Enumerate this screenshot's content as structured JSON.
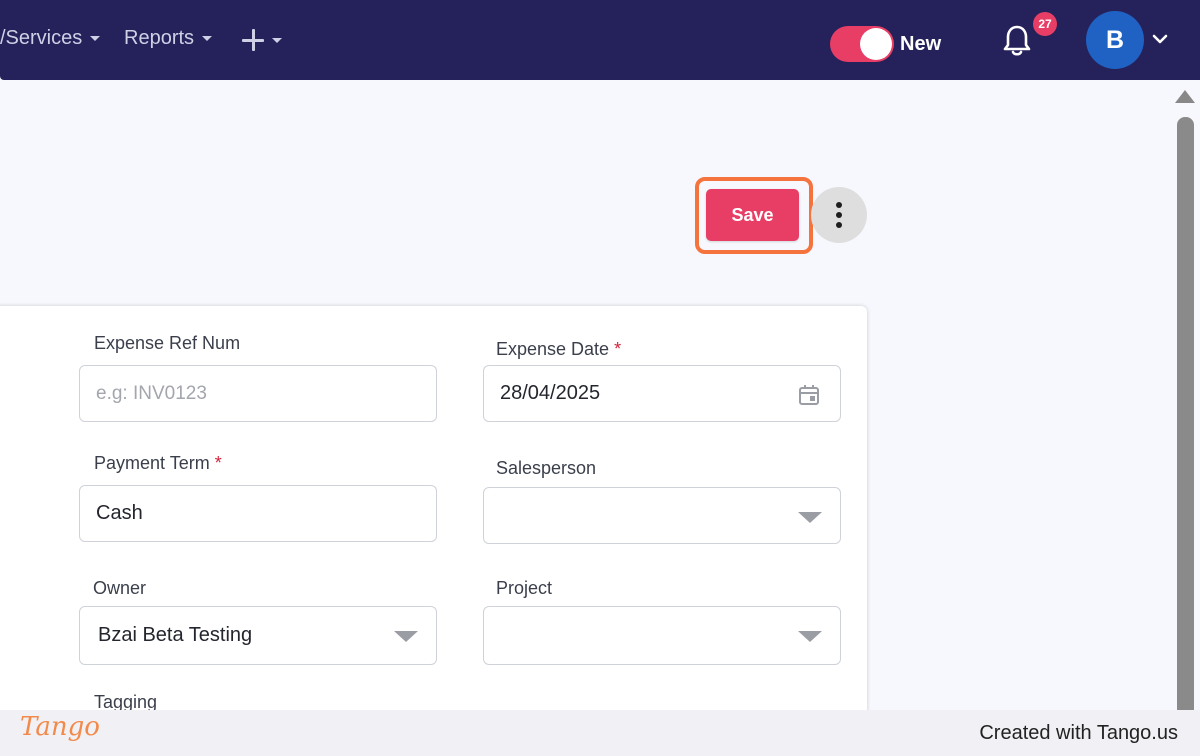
{
  "nav": {
    "items": [
      {
        "label": "/Services"
      },
      {
        "label": "Reports"
      }
    ],
    "toggle_label": "New",
    "notification_count": "27",
    "avatar_initial": "B"
  },
  "toolbar": {
    "save_label": "Save"
  },
  "form": {
    "expense_ref": {
      "label": "Expense Ref Num",
      "placeholder": "e.g: INV0123",
      "value": ""
    },
    "expense_date": {
      "label": "Expense Date",
      "required": "*",
      "value": "28/04/2025"
    },
    "payment_term": {
      "label": "Payment Term",
      "required": "*",
      "value": "Cash"
    },
    "salesperson": {
      "label": "Salesperson",
      "value": ""
    },
    "owner": {
      "label": "Owner",
      "value": "Bzai Beta Testing"
    },
    "project": {
      "label": "Project",
      "value": ""
    },
    "tagging": {
      "label": "Tagging"
    }
  },
  "footer": {
    "logo": "Tango",
    "credit": "Created with Tango.us"
  },
  "colors": {
    "nav_bg": "#25215a",
    "accent": "#e83e66",
    "highlight": "#f5743d",
    "avatar": "#1f62c4"
  }
}
